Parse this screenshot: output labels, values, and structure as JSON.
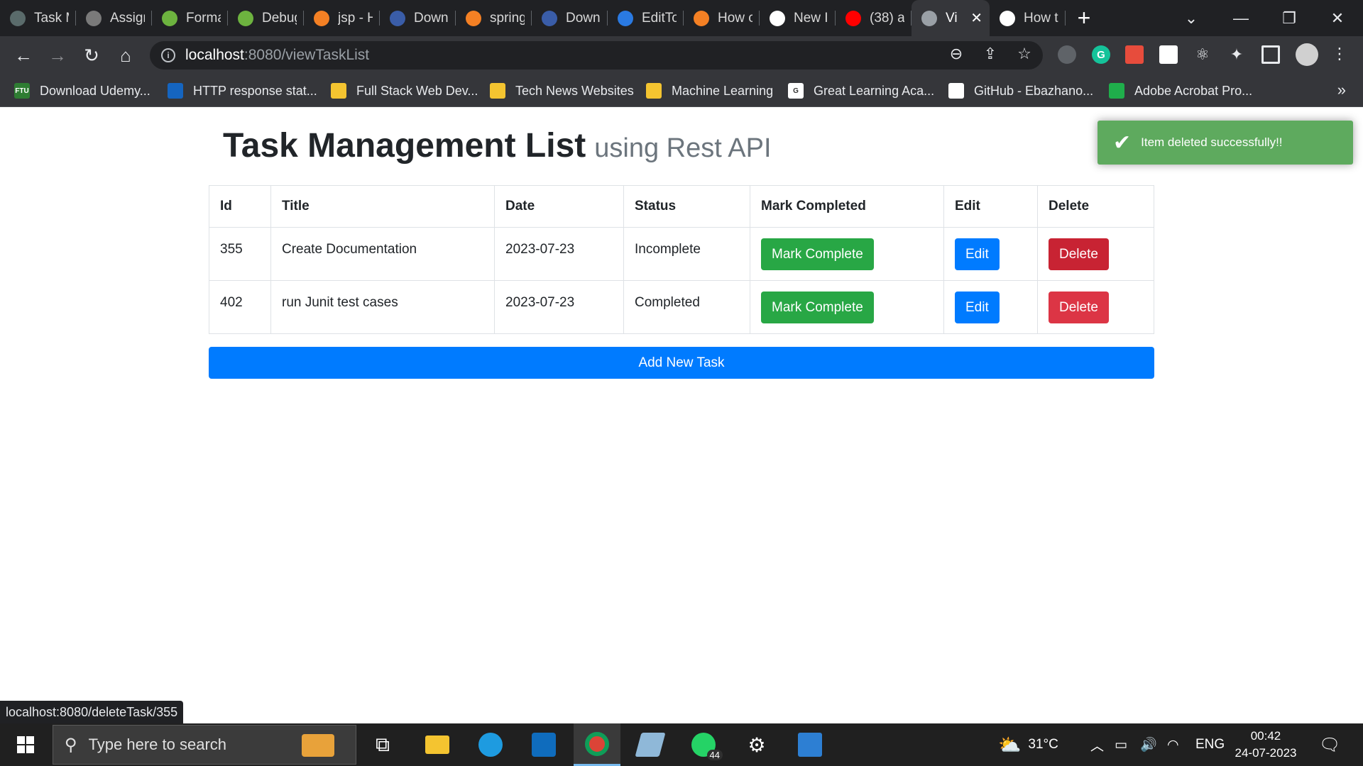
{
  "browser": {
    "tabs": [
      {
        "label": "Task M",
        "icon": "openai-icon",
        "color": "#5a6b6b"
      },
      {
        "label": "Assign",
        "icon": "globe-icon",
        "color": "#7a7a7a"
      },
      {
        "label": "Forma",
        "icon": "spring-icon",
        "color": "#6db33f"
      },
      {
        "label": "Debug",
        "icon": "spring-icon",
        "color": "#6db33f"
      },
      {
        "label": "jsp - H",
        "icon": "stackoverflow-icon",
        "color": "#f48024"
      },
      {
        "label": "Down",
        "icon": "book-icon",
        "color": "#3a5da8"
      },
      {
        "label": "spring",
        "icon": "stackoverflow-icon",
        "color": "#f48024"
      },
      {
        "label": "Down",
        "icon": "book-icon",
        "color": "#3a5da8"
      },
      {
        "label": "EditTo",
        "icon": "robot-icon",
        "color": "#2a7ae2"
      },
      {
        "label": "How c",
        "icon": "stackoverflow-icon",
        "color": "#f48024"
      },
      {
        "label": "New I",
        "icon": "github-icon",
        "color": "#ffffff"
      },
      {
        "label": "(38) a",
        "icon": "youtube-icon",
        "color": "#ff0000"
      },
      {
        "label": "Vi",
        "icon": "globe-icon",
        "color": "#9aa0a6",
        "active": true
      },
      {
        "label": "How t",
        "icon": "medium-icon",
        "color": "#ffffff"
      }
    ],
    "url_host": "localhost",
    "url_path": ":8080/viewTaskList",
    "bookmarks": [
      {
        "label": "Download Udemy...",
        "icon": "ftu-icon",
        "badge": "FTU",
        "color": "#2e7d32"
      },
      {
        "label": "HTTP response stat...",
        "icon": "mdn-icon",
        "badge": "",
        "color": "#1565c0"
      },
      {
        "label": "Full Stack Web Dev...",
        "icon": "folder-icon",
        "badge": "",
        "color": "#f4c430"
      },
      {
        "label": "Tech News Websites",
        "icon": "folder-icon",
        "badge": "",
        "color": "#f4c430"
      },
      {
        "label": "Machine Learning",
        "icon": "folder-icon",
        "badge": "",
        "color": "#f4c430"
      },
      {
        "label": "Great Learning Aca...",
        "icon": "google-icon",
        "badge": "G",
        "color": "#ffffff"
      },
      {
        "label": "GitHub - Ebazhano...",
        "icon": "github-icon",
        "badge": "",
        "color": "#ffffff"
      },
      {
        "label": "Adobe Acrobat Pro...",
        "icon": "acrobat-icon",
        "badge": "",
        "color": "#1fae4b"
      }
    ],
    "status_url": "localhost:8080/deleteTask/355"
  },
  "page": {
    "title": "Task Management List",
    "subtitle": "using Rest API",
    "table": {
      "headers": [
        "Id",
        "Title",
        "Date",
        "Status",
        "Mark Completed",
        "Edit",
        "Delete"
      ],
      "rows": [
        {
          "id": "355",
          "title": "Create Documentation",
          "date": "2023-07-23",
          "status": "Incomplete",
          "mark": "Mark Complete",
          "edit": "Edit",
          "delete": "Delete"
        },
        {
          "id": "402",
          "title": "run Junit test cases",
          "date": "2023-07-23",
          "status": "Completed",
          "mark": "Mark Complete",
          "edit": "Edit",
          "delete": "Delete"
        }
      ]
    },
    "add_button": "Add New Task",
    "toast": "Item deleted successfully!!"
  },
  "taskbar": {
    "search_placeholder": "Type here to search",
    "whatsapp_badge": "44",
    "temperature": "31°C",
    "language": "ENG",
    "time": "00:42",
    "date": "24-07-2023"
  },
  "colors": {
    "success": "#28a745",
    "primary": "#007bff",
    "danger": "#dc3545",
    "toast": "#51a351"
  }
}
